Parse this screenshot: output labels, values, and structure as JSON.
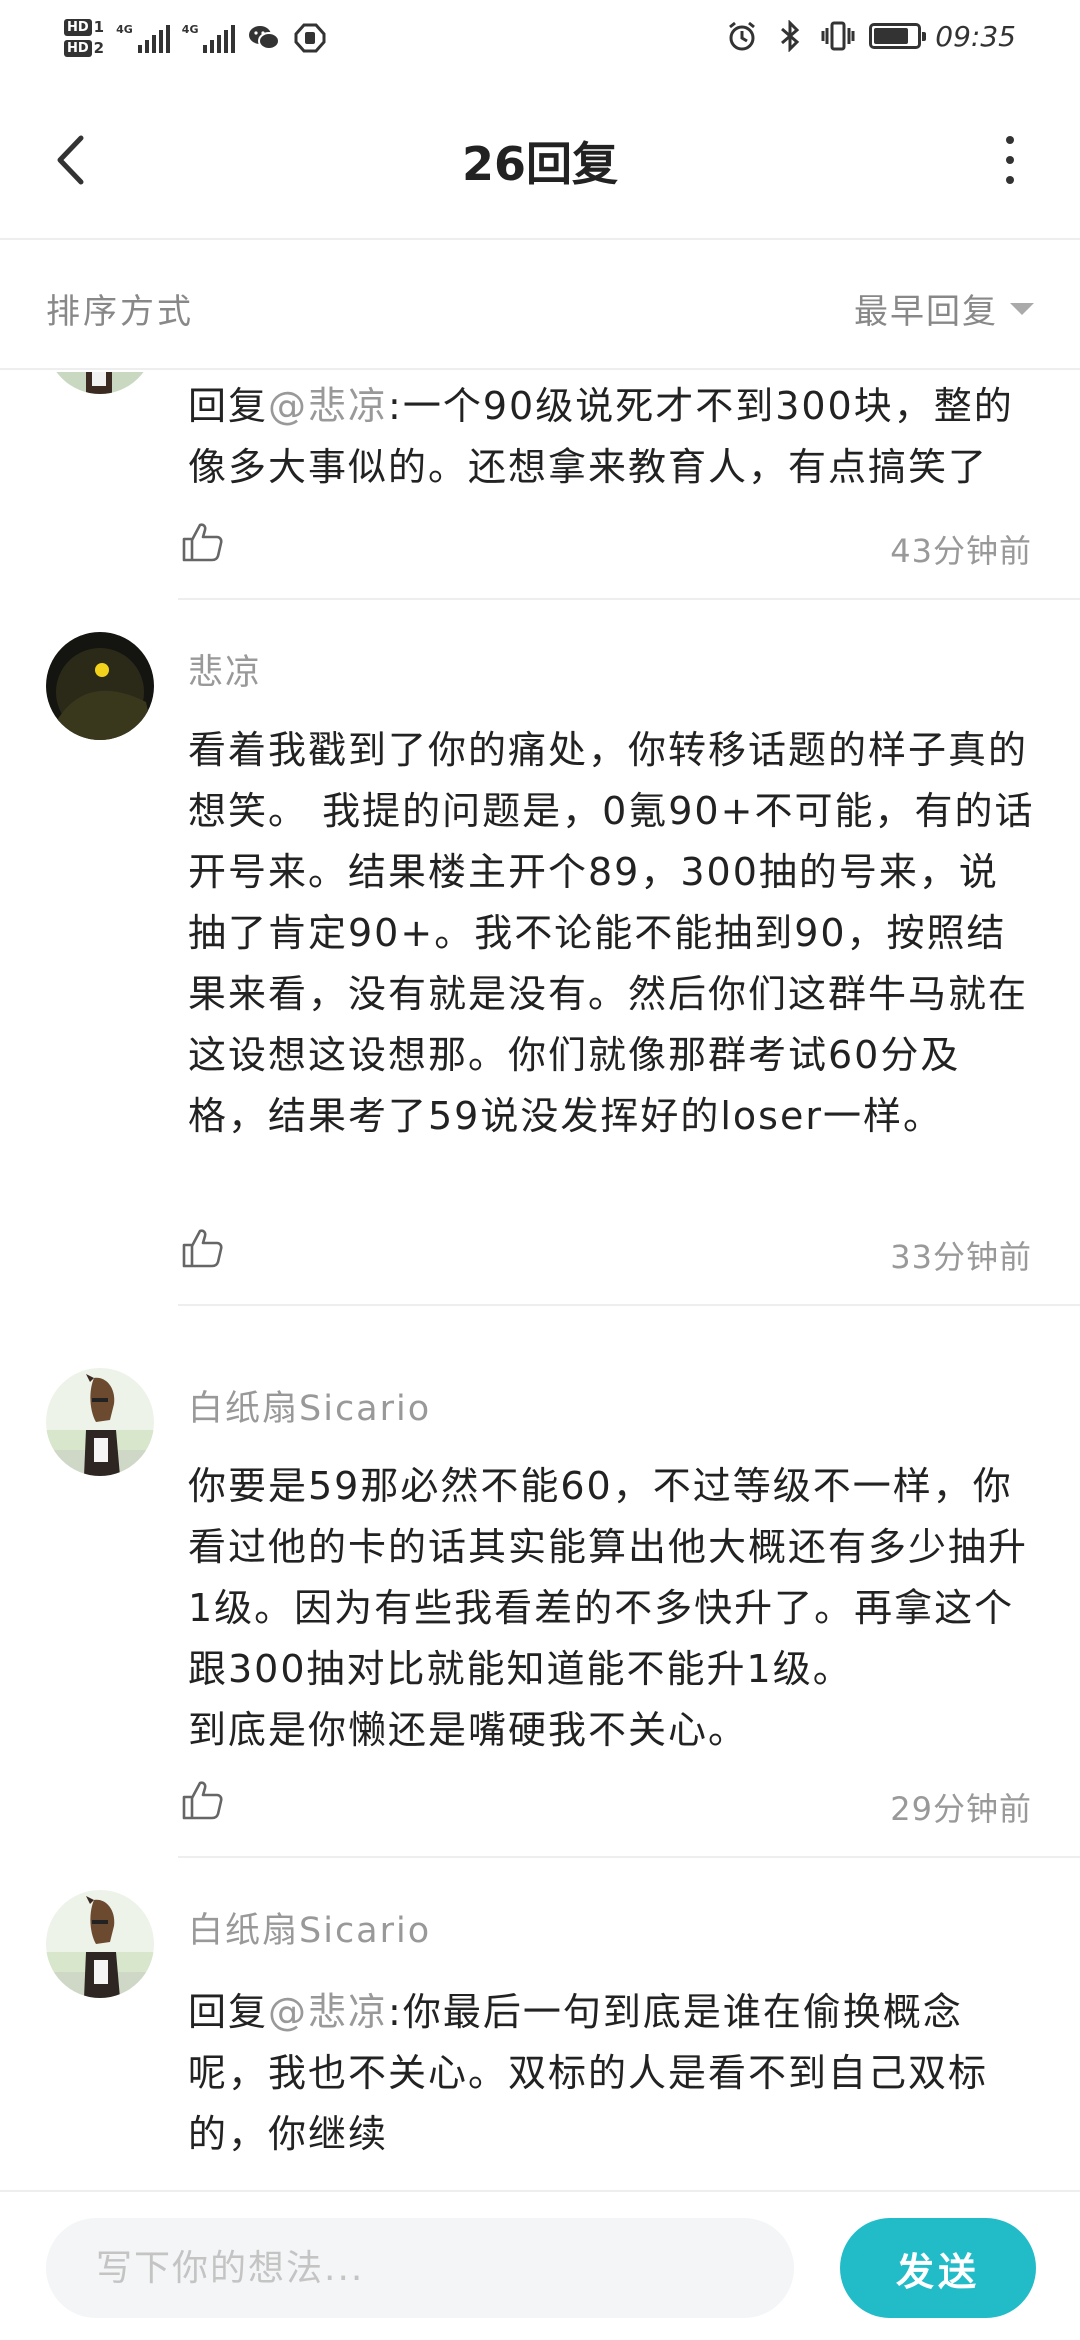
{
  "status_bar": {
    "sim1": "HD",
    "sim1_index": "1",
    "sim2": "HD",
    "sim2_index": "2",
    "network1": "4G",
    "network2": "4G",
    "battery_level": 0.8,
    "time": "09:35",
    "icons": [
      "wechat-icon",
      "shield-icon",
      "alarm-icon",
      "bluetooth-icon",
      "vibrate-icon",
      "battery-icon"
    ]
  },
  "header": {
    "title": "26回复"
  },
  "sort": {
    "label": "排序方式",
    "selected": "最早回复"
  },
  "replies": [
    {
      "content_prefix": "回复",
      "mention": "@悲凉",
      "content": ":一个90级说死才不到300块，整的像多大事似的。还想拿来教育人，有点搞笑了",
      "time": "43分钟前"
    },
    {
      "author": "悲凉",
      "content": "看着我戳到了你的痛处，你转移话题的样子真的想笑。  我提的问题是，0氪90+不可能，有的话开号来。结果楼主开个89，300抽的号来，说抽了肯定90+。我不论能不能抽到90，按照结果来看，没有就是没有。然后你们这群牛马就在这设想这设想那。你们就像那群考试60分及格，结果考了59说没发挥好的loser一样。",
      "time": "33分钟前"
    },
    {
      "author": "白纸扇Sicario",
      "content": "你要是59那必然不能60，不过等级不一样，你看过他的卡的话其实能算出他大概还有多少抽升1级。因为有些我看差的不多快升了。再拿这个跟300抽对比就能知道能不能升1级。\n到底是你懒还是嘴硬我不关心。",
      "time": "29分钟前"
    },
    {
      "author": "白纸扇Sicario",
      "content_prefix": "回复",
      "mention": "@悲凉",
      "content": ":你最后一句到底是谁在偷换概念呢，我也不关心。双标的人是看不到自己双标的，你继续"
    }
  ],
  "composer": {
    "placeholder": "写下你的想法...",
    "send_label": "发送"
  },
  "colors": {
    "accent": "#22bcc8",
    "muted_text": "#999999",
    "body_text": "#222222"
  }
}
